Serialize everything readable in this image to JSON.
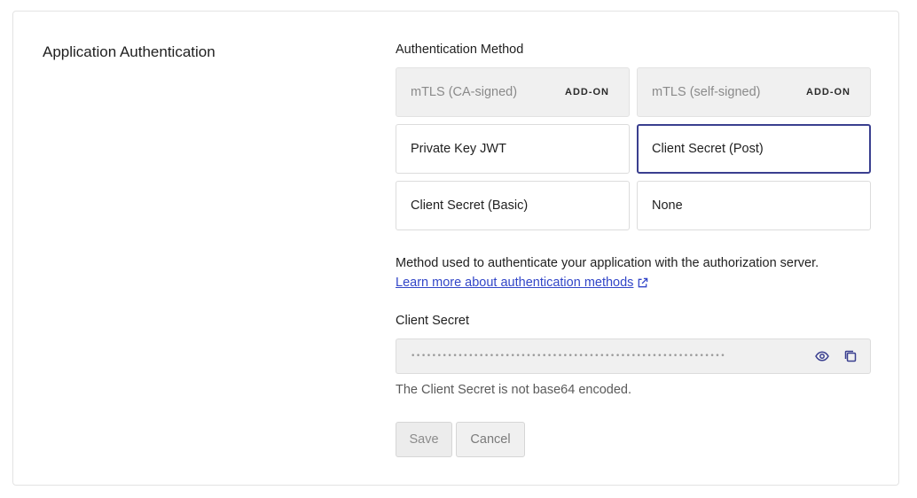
{
  "section": {
    "title": "Application Authentication"
  },
  "auth_method": {
    "label": "Authentication Method",
    "options": [
      {
        "label": "mTLS (CA-signed)",
        "badge": "ADD-ON",
        "state": "disabled"
      },
      {
        "label": "mTLS (self-signed)",
        "badge": "ADD-ON",
        "state": "disabled"
      },
      {
        "label": "Private Key JWT",
        "state": "normal"
      },
      {
        "label": "Client Secret (Post)",
        "state": "selected"
      },
      {
        "label": "Client Secret (Basic)",
        "state": "normal"
      },
      {
        "label": "None",
        "state": "normal"
      }
    ],
    "description": "Method used to authenticate your application with the authorization server.",
    "learn_more": "Learn more about authentication methods"
  },
  "client_secret": {
    "label": "Client Secret",
    "masked_value": "••••••••••••••••••••••••••••••••••••••••••••••••••••••••••••",
    "hint": "The Client Secret is not base64 encoded."
  },
  "actions": {
    "save_label": "Save",
    "cancel_label": "Cancel"
  },
  "colors": {
    "selected_border": "#3a3f8f",
    "link": "#3246c8"
  }
}
